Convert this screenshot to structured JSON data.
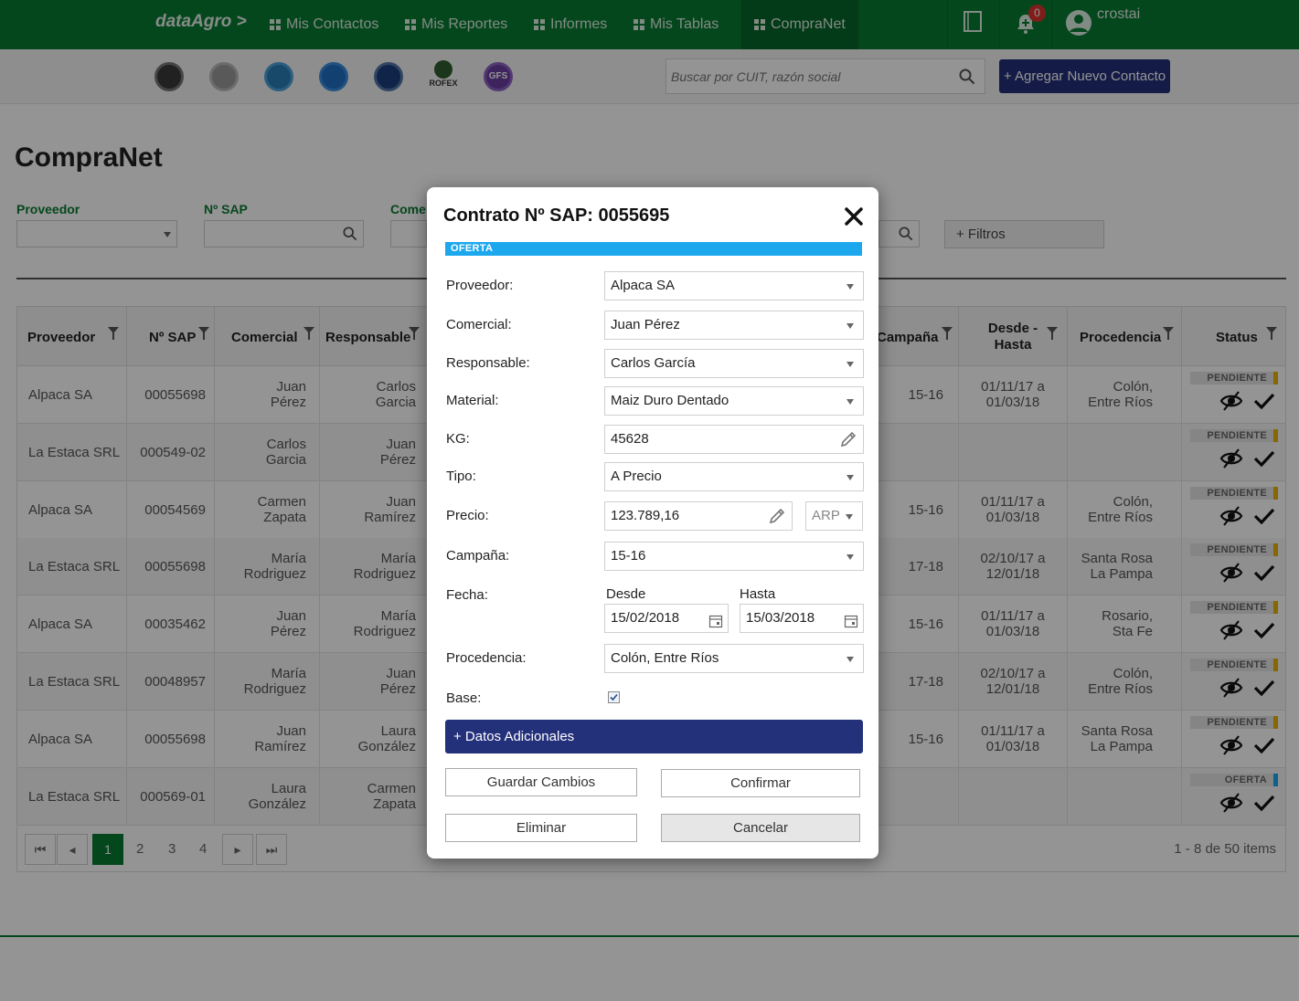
{
  "nav": {
    "brand": "dataAgro >",
    "items": [
      {
        "label": "Mis Contactos"
      },
      {
        "label": "Mis Reportes"
      },
      {
        "label": "Informes"
      },
      {
        "label": "Mis Tablas"
      },
      {
        "label": "CompraNet"
      }
    ],
    "notification_count": "0",
    "user": "crostai"
  },
  "subbar": {
    "logos": [
      "logo-1",
      "logo-2",
      "logo-3",
      "logo-4",
      "logo-5",
      "ROFEX",
      "GFS"
    ],
    "search_placeholder": "Buscar por CUIT, razón social",
    "add_button": "+ Agregar Nuevo Contacto"
  },
  "page": {
    "title": "CompraNet",
    "filters": {
      "proveedor": "Proveedor",
      "sap": "Nº SAP",
      "comercial": "Come",
      "filtros_button": "+ Filtros"
    }
  },
  "table": {
    "headers": [
      "Proveedor",
      "Nº SAP",
      "Comercial",
      "Responsable",
      "Campaña",
      "Desde - Hasta",
      "Procedencia",
      "Status"
    ],
    "rows": [
      {
        "proveedor": "Alpaca SA",
        "sap": "00055698",
        "comercial": "Juan Pérez",
        "comercial_l1": "Juan",
        "comercial_l2": "Pérez",
        "responsable_l1": "Carlos",
        "responsable_l2": "Garcia",
        "campana": "15-16",
        "desde": "01/11/17 a",
        "hasta": "01/03/18",
        "proc_l1": "Colón,",
        "proc_l2": "Entre Ríos",
        "status": "PENDIENTE"
      },
      {
        "proveedor": "La Estaca SRL",
        "sap": "000549-02",
        "comercial_l1": "Carlos",
        "comercial_l2": "Garcia",
        "responsable_l1": "Juan",
        "responsable_l2": "Pérez",
        "campana": "",
        "desde": "",
        "hasta": "",
        "proc_l1": "",
        "proc_l2": "",
        "status": "PENDIENTE"
      },
      {
        "proveedor": "Alpaca SA",
        "sap": "00054569",
        "comercial_l1": "Carmen",
        "comercial_l2": "Zapata",
        "responsable_l1": "Juan",
        "responsable_l2": "Ramírez",
        "campana": "15-16",
        "desde": "01/11/17 a",
        "hasta": "01/03/18",
        "proc_l1": "Colón,",
        "proc_l2": "Entre Ríos",
        "status": "PENDIENTE"
      },
      {
        "proveedor": "La Estaca SRL",
        "sap": "00055698",
        "comercial_l1": "María",
        "comercial_l2": "Rodriguez",
        "responsable_l1": "María",
        "responsable_l2": "Rodriguez",
        "campana": "17-18",
        "desde": "02/10/17 a",
        "hasta": "12/01/18",
        "proc_l1": "Santa Rosa",
        "proc_l2": "La Pampa",
        "status": "PENDIENTE"
      },
      {
        "proveedor": "Alpaca SA",
        "sap": "00035462",
        "comercial_l1": "Juan",
        "comercial_l2": "Pérez",
        "responsable_l1": "María",
        "responsable_l2": "Rodriguez",
        "campana": "15-16",
        "desde": "01/11/17 a",
        "hasta": "01/03/18",
        "proc_l1": "Rosario,",
        "proc_l2": "Sta Fe",
        "status": "PENDIENTE"
      },
      {
        "proveedor": "La Estaca SRL",
        "sap": "00048957",
        "comercial_l1": "María",
        "comercial_l2": "Rodriguez",
        "responsable_l1": "Juan",
        "responsable_l2": "Pérez",
        "campana": "17-18",
        "desde": "02/10/17 a",
        "hasta": "12/01/18",
        "proc_l1": "Colón,",
        "proc_l2": "Entre Ríos",
        "status": "PENDIENTE"
      },
      {
        "proveedor": "Alpaca SA",
        "sap": "00055698",
        "comercial_l1": "Juan",
        "comercial_l2": "Ramírez",
        "responsable_l1": "Laura",
        "responsable_l2": "González",
        "campana": "15-16",
        "desde": "01/11/17 a",
        "hasta": "01/03/18",
        "proc_l1": "Santa Rosa",
        "proc_l2": "La Pampa",
        "status": "PENDIENTE"
      },
      {
        "proveedor": "La Estaca SRL",
        "sap": "000569-01",
        "comercial_l1": "Laura",
        "comercial_l2": "González",
        "responsable_l1": "Carmen",
        "responsable_l2": "Zapata",
        "campana": "",
        "desde": "",
        "hasta": "",
        "proc_l1": "",
        "proc_l2": "",
        "status": "OFERTA"
      }
    ],
    "pager": {
      "pages": [
        "1",
        "2",
        "3",
        "4"
      ],
      "info": "1 - 8 de 50 items"
    }
  },
  "modal": {
    "title": "Contrato Nº SAP: 0055695",
    "status": "OFERTA",
    "labels": {
      "proveedor": "Proveedor:",
      "comercial": "Comercial:",
      "responsable": "Responsable:",
      "material": "Material:",
      "kg": "KG:",
      "tipo": "Tipo:",
      "precio": "Precio:",
      "campana": "Campaña:",
      "fecha": "Fecha:",
      "desde": "Desde",
      "hasta": "Hasta",
      "procedencia": "Procedencia:",
      "base": "Base:"
    },
    "values": {
      "proveedor": "Alpaca SA",
      "comercial": "Juan Pérez",
      "responsable": "Carlos García",
      "material": "Maiz Duro Dentado",
      "kg": "45628",
      "tipo": "A Precio",
      "precio": "123.789,16",
      "moneda": "ARP",
      "campana": "15-16",
      "desde": "15/02/2018",
      "hasta": "15/03/2018",
      "procedencia": "Colón, Entre Ríos",
      "base_checked": true
    },
    "datos_adicionales": "+ Datos Adicionales",
    "buttons": {
      "guardar": "Guardar Cambios",
      "confirmar": "Confirmar",
      "eliminar": "Eliminar",
      "cancelar": "Cancelar"
    }
  },
  "colors": {
    "brand_green": "#0a7a32",
    "navy": "#23307a",
    "oferta_blue": "#1da8ee",
    "pendiente_yellow": "#e8b400"
  }
}
